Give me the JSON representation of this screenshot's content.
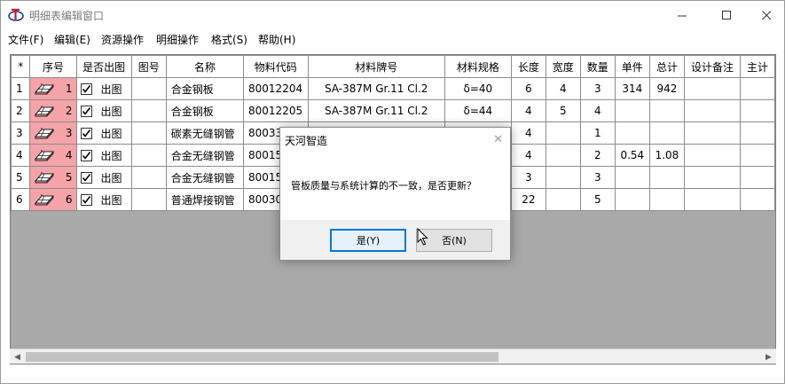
{
  "window": {
    "title": "明细表编辑窗口"
  },
  "menu": [
    "文件(F)",
    "编辑(E)",
    "资源操作",
    "明细操作",
    "格式(S)",
    "帮助(H)"
  ],
  "table": {
    "columns": [
      "*",
      "序号",
      "是否出图",
      "图号",
      "名称",
      "物料代码",
      "材料牌号",
      "材料规格",
      "长度",
      "宽度",
      "数量",
      "单件",
      "总计",
      "设计备注",
      "主计"
    ],
    "rows": [
      {
        "rownum": "1",
        "seq": "1",
        "print_label": "出图",
        "drawing_no": "",
        "name": "合金钢板",
        "code": "80012204",
        "grade": "SA-387M Gr.11 Cl.2",
        "spec": "δ=40",
        "length": "6",
        "width": "4",
        "qty": "3",
        "unit_wt": "314",
        "total_wt": "942",
        "remark": "",
        "main": ""
      },
      {
        "rownum": "2",
        "seq": "2",
        "print_label": "出图",
        "drawing_no": "",
        "name": "合金钢板",
        "code": "80012205",
        "grade": "SA-387M Gr.11 Cl.2",
        "spec": "δ=44",
        "length": "4",
        "width": "5",
        "qty": "4",
        "unit_wt": "",
        "total_wt": "",
        "remark": "",
        "main": ""
      },
      {
        "rownum": "3",
        "seq": "3",
        "print_label": "出图",
        "drawing_no": "",
        "name": "碳素无缝钢管",
        "code": "800331",
        "grade": "",
        "spec": "",
        "length": "4",
        "width": "",
        "qty": "1",
        "unit_wt": "",
        "total_wt": "",
        "remark": "",
        "main": ""
      },
      {
        "rownum": "4",
        "seq": "4",
        "print_label": "出图",
        "drawing_no": "",
        "name": "合金无缝钢管",
        "code": "80015",
        "grade": "",
        "spec": "",
        "length": "4",
        "width": "",
        "qty": "2",
        "unit_wt": "0.54",
        "total_wt": "1.08",
        "remark": "",
        "main": ""
      },
      {
        "rownum": "5",
        "seq": "5",
        "print_label": "出图",
        "drawing_no": "",
        "name": "合金无缝钢管",
        "code": "80015",
        "grade": "",
        "spec": "",
        "length": "3",
        "width": "",
        "qty": "3",
        "unit_wt": "",
        "total_wt": "",
        "remark": "",
        "main": ""
      },
      {
        "rownum": "6",
        "seq": "6",
        "print_label": "出图",
        "drawing_no": "",
        "name": "普通焊接钢管",
        "code": "80030",
        "grade": "",
        "spec": "",
        "length": "22",
        "width": "",
        "qty": "5",
        "unit_wt": "",
        "total_wt": "",
        "remark": "",
        "main": ""
      }
    ]
  },
  "dialog": {
    "title": "天河智造",
    "message": "管板质量与系统计算的不一致，是否更新？",
    "yes_label": "是(Y)",
    "no_label": "否(N)"
  },
  "colors": {
    "seq_cell": "#f4a3a9",
    "empty_grid": "#a9a9a9",
    "default_button_border": "#0078d7",
    "dialog_footer": "#f0f0f0"
  },
  "icons": {
    "app": "tianhe-app-icon",
    "seq": "eraser-icon",
    "check": "checkmark-icon"
  }
}
